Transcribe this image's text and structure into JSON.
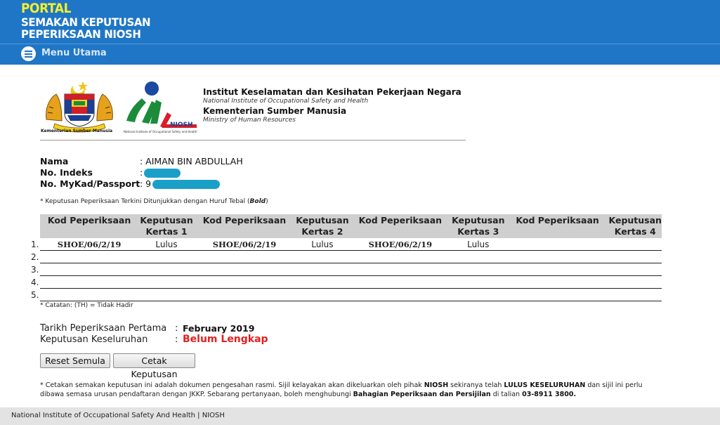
{
  "header": {
    "portal": "PORTAL",
    "title_line1": "SEMAKAN KEPUTUSAN",
    "title_line2": "PEPERIKSAAN NIOSH",
    "menu_label": "Menu Utama",
    "bg_color": "#1f76c6",
    "portal_color": "#f6ef2a"
  },
  "logos": {
    "crest_caption": "Kementerian Sumber Manusia",
    "niosh_text": "NIOSH",
    "niosh_caption": "National Institute of Occupational Safety and Health"
  },
  "institute": {
    "line1": "Institut Keselamatan dan Kesihatan Pekerjaan Negara",
    "line2": "National Institute of Occupational Safety and Health",
    "line3": "Kementerian Sumber Manusia",
    "line4": "Ministry of Human Resources"
  },
  "candidate": {
    "name_label": "Nama",
    "name_value": ": AIMAN BIN ABDULLAH",
    "index_label": "No. Indeks",
    "index_value": ":",
    "mykad_label": "No. MyKad/Passport",
    "mykad_value": ": 9"
  },
  "note_bold": "* Keputusan Peperiksaan Terkini Ditunjukkan dengan Huruf Tebal (",
  "note_bold_word": "Bold",
  "note_bold_end": ")",
  "table": {
    "headers": [
      "Kod Peperiksaan",
      "Keputusan Kertas 1",
      "Kod Peperiksaan",
      "Keputusan Kertas 2",
      "Kod Peperiksaan",
      "Keputusan Kertas 3",
      "Kod Peperiksaan",
      "Keputusan Kertas 4"
    ],
    "row_numbers": [
      "1.",
      "2.",
      "3.",
      "4.",
      "5."
    ],
    "rows": [
      [
        "SHOE/06/2/19",
        "Lulus",
        "SHOE/06/2/19",
        "Lulus",
        "SHOE/06/2/19",
        "Lulus",
        "",
        ""
      ],
      [
        "",
        "",
        "",
        "",
        "",
        "",
        "",
        ""
      ],
      [
        "",
        "",
        "",
        "",
        "",
        "",
        "",
        ""
      ],
      [
        "",
        "",
        "",
        "",
        "",
        "",
        "",
        ""
      ],
      [
        "",
        "",
        "",
        "",
        "",
        "",
        "",
        ""
      ]
    ]
  },
  "note_th": "* Catatan: (TH) = Tidak Hadir",
  "summary": {
    "first_exam_label": "Tarikh Peperiksaan Pertama",
    "first_exam_value": "February 2019",
    "overall_label": "Keputusan Keseluruhan",
    "overall_value": "Belum Lengkap",
    "colon": ":",
    "status_color": "#e41f1f"
  },
  "buttons": {
    "reset": "Reset Semula",
    "print": "Cetak Keputusan"
  },
  "notice": {
    "p1": "* Cetakan semakan keputusan ini adalah dokumen pengesahan rasmi. Sijil kelayakan akan dikeluarkan oleh pihak ",
    "b1": "NIOSH",
    "p2": " sekiranya telah ",
    "b2": "LULUS KESELURUHAN",
    "p3": " dan sijil ini perlu dibawa semasa urusan pendaftaran dengan JKKP. Sebarang pertanyaan, boleh menghubungi ",
    "b3": "Bahagian Peperiksaan dan Persijilan",
    "p4": " di talian ",
    "b4": "03-8911 3800."
  },
  "footer": {
    "text": "National Institute of Occupational Safety And Health | NIOSH"
  }
}
